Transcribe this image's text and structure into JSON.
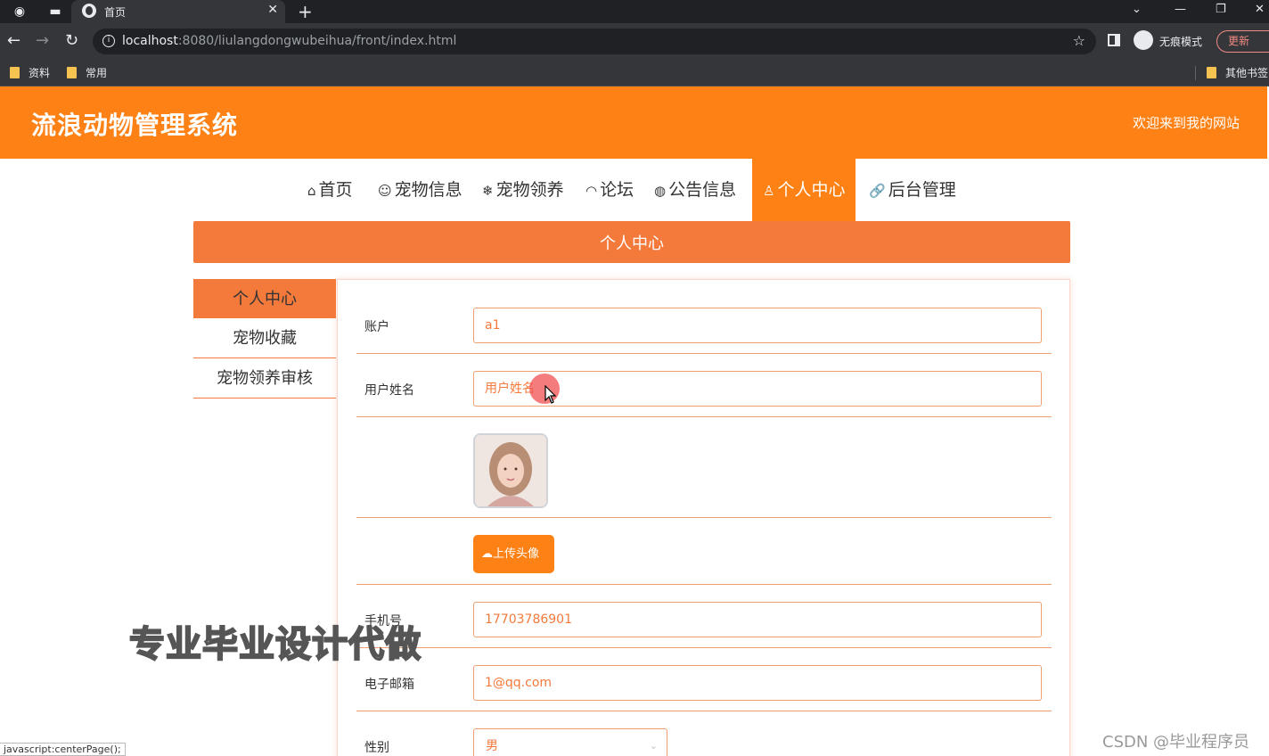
{
  "browser": {
    "tab_title": "首页",
    "url_host": "localhost",
    "url_rest": ":8080/liulangdongwubeihua/front/index.html",
    "incognito_label": "无痕模式",
    "update_label": "更新",
    "bookmarks": [
      "资料",
      "常用"
    ],
    "other_bookmarks": "其他书签",
    "status_text": "javascript:centerPage();"
  },
  "header": {
    "site_title": "流浪动物管理系统",
    "welcome": "欢迎来到我的网站"
  },
  "nav": {
    "items": [
      {
        "icon": "home-icon",
        "glyph": "⌂",
        "label": "首页"
      },
      {
        "icon": "pet-face-icon",
        "glyph": "☺",
        "label": "宠物信息"
      },
      {
        "icon": "snowflake-icon",
        "glyph": "❄",
        "label": "宠物领养"
      },
      {
        "icon": "speedometer-icon",
        "glyph": "◠",
        "label": "论坛"
      },
      {
        "icon": "globe-icon",
        "glyph": "◍",
        "label": "公告信息"
      },
      {
        "icon": "user-icon",
        "glyph": "♙",
        "label": "个人中心"
      },
      {
        "icon": "link-icon",
        "glyph": "🔗",
        "label": "后台管理"
      }
    ],
    "active_index": 5
  },
  "banner": {
    "title": "个人中心"
  },
  "side_menu": {
    "items": [
      "个人中心",
      "宠物收藏",
      "宠物领养审核"
    ]
  },
  "form": {
    "account_label": "账户",
    "account_value": "a1",
    "name_label": "用户姓名",
    "name_placeholder": "用户姓名",
    "upload_label": "上传头像",
    "phone_label": "手机号",
    "phone_value": "17703786901",
    "email_label": "电子邮箱",
    "email_value": "1@qq.com",
    "gender_label": "性别",
    "gender_value": "男"
  },
  "overlay": {
    "watermark": "专业毕业设计代做",
    "csdn": "CSDN @毕业程序员"
  },
  "colors": {
    "brand_orange": "#fd8115",
    "banner_orange": "#f47a3c"
  }
}
